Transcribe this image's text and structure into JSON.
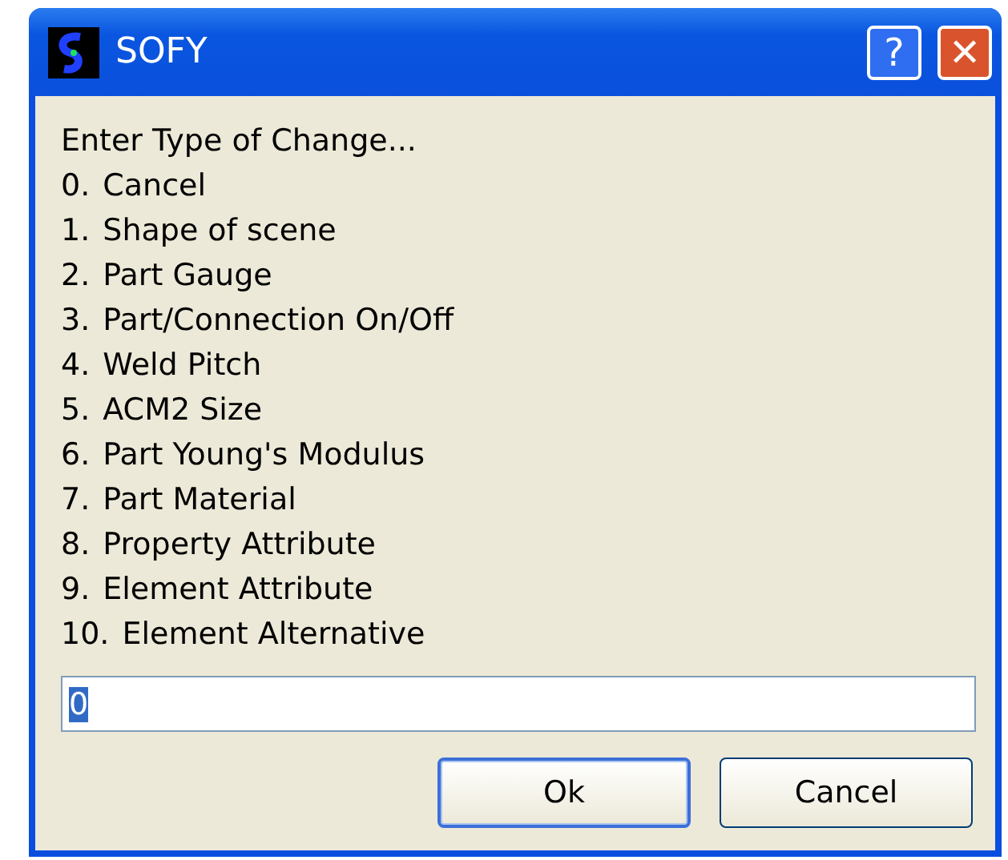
{
  "window": {
    "title": "SOFY",
    "title_buttons": [
      {
        "kind": "help",
        "label": "?"
      },
      {
        "kind": "close",
        "label": "✕"
      }
    ]
  },
  "prompt": "Enter Type of Change...",
  "options": [
    {
      "number": "0.",
      "label": "Cancel"
    },
    {
      "number": "1.",
      "label": "Shape of scene"
    },
    {
      "number": "2.",
      "label": "Part Gauge"
    },
    {
      "number": "3.",
      "label": "Part/Connection On/Off"
    },
    {
      "number": "4.",
      "label": "Weld Pitch"
    },
    {
      "number": "5.",
      "label": "ACM2 Size"
    },
    {
      "number": "6.",
      "label": "Part Young's Modulus"
    },
    {
      "number": "7.",
      "label": "Part Material"
    },
    {
      "number": "8.",
      "label": "Property Attribute"
    },
    {
      "number": "9.",
      "label": "Element Attribute"
    },
    {
      "number": "10.",
      "label": "Element Alternative"
    }
  ],
  "input": {
    "value": "0",
    "selected": true
  },
  "buttons": [
    {
      "label": "Ok",
      "default": true
    },
    {
      "label": "Cancel",
      "default": false
    }
  ]
}
